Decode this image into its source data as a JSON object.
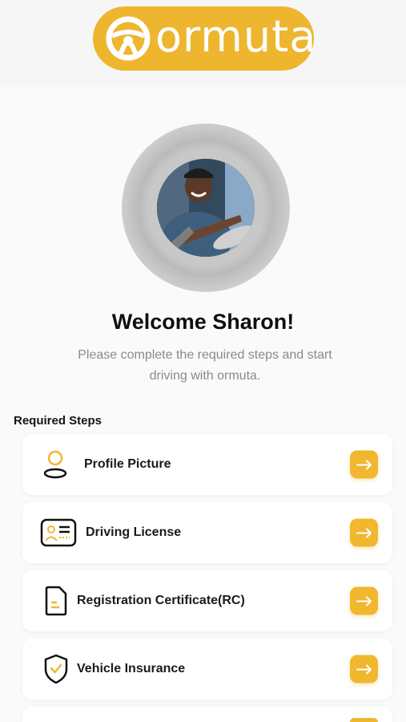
{
  "brand": {
    "name": "ormuta",
    "color": "#eeb52e"
  },
  "welcome": {
    "title": "Welcome Sharon!",
    "subtitle": "Please complete the required steps and start driving with ormuta."
  },
  "steps": {
    "title": "Required Steps",
    "items": [
      {
        "label": "Profile Picture",
        "icon": "person-icon"
      },
      {
        "label": "Driving License",
        "icon": "id-card-icon"
      },
      {
        "label": "Registration Certificate(RC)",
        "icon": "document-icon"
      },
      {
        "label": "Vehicle Insurance",
        "icon": "shield-check-icon"
      }
    ],
    "arrow_icon": "arrow-right-icon",
    "accent_color": "#f0b72f"
  }
}
